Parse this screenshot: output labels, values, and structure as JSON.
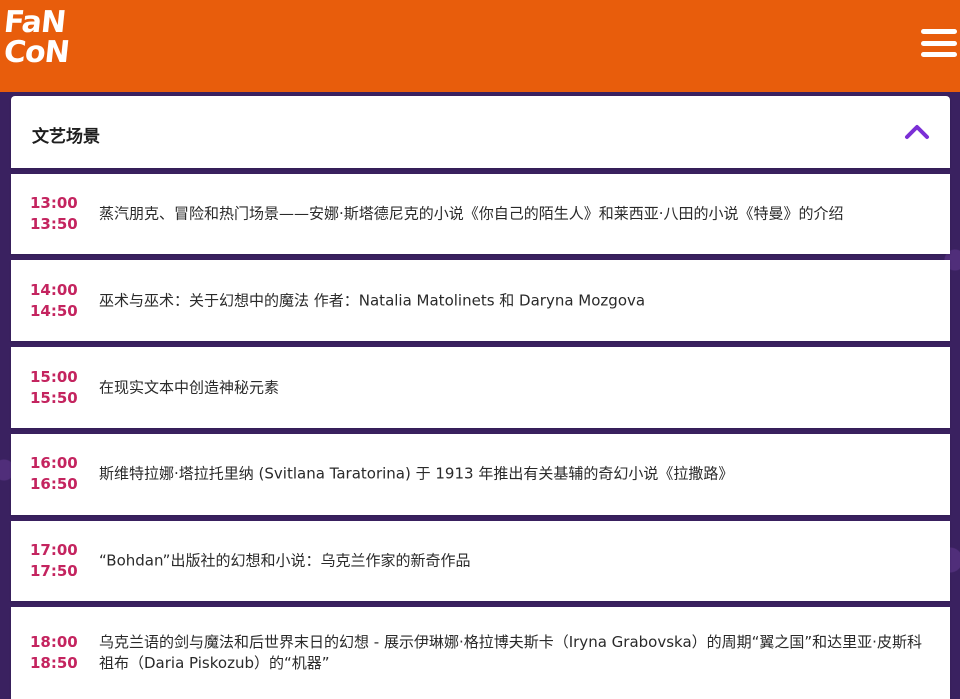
{
  "brand": {
    "logo_line1": "FaN",
    "logo_line2": "CoN"
  },
  "section": {
    "title": "文艺场景"
  },
  "colors": {
    "topbar": "#e85d0c",
    "accent_time": "#c4245f",
    "chevron": "#7b2fd6",
    "background": "#3a2160"
  },
  "icons": {
    "menu": "hamburger-menu-icon",
    "collapse": "chevron-up-icon"
  },
  "schedule": [
    {
      "start": "13:00",
      "end": "13:50",
      "title": "蒸汽朋克、冒险和热门场景——安娜·斯塔德尼克的小说《你自己的陌生人》和莱西亚·八田的小说《特曼》的介绍"
    },
    {
      "start": "14:00",
      "end": "14:50",
      "title": "巫术与巫术：关于幻想中的魔法 作者：Natalia Matolinets 和 Daryna Mozgova"
    },
    {
      "start": "15:00",
      "end": "15:50",
      "title": "在现实文本中创造神秘元素"
    },
    {
      "start": "16:00",
      "end": "16:50",
      "title": "斯维特拉娜·塔拉托里纳 (Svitlana Taratorina) 于 1913 年推出有关基辅的奇幻小说《拉撒路》"
    },
    {
      "start": "17:00",
      "end": "17:50",
      "title": "“Bohdan”出版社的幻想和小说：乌克兰作家的新奇作品"
    },
    {
      "start": "18:00",
      "end": "18:50",
      "title": "乌克兰语的剑与魔法和后世界末日的幻想 - 展示伊琳娜·格拉博夫斯卡（Iryna Grabovska）的周期“翼之国”和达里亚·皮斯科祖布（Daria Piskozub）的“机器”"
    }
  ]
}
